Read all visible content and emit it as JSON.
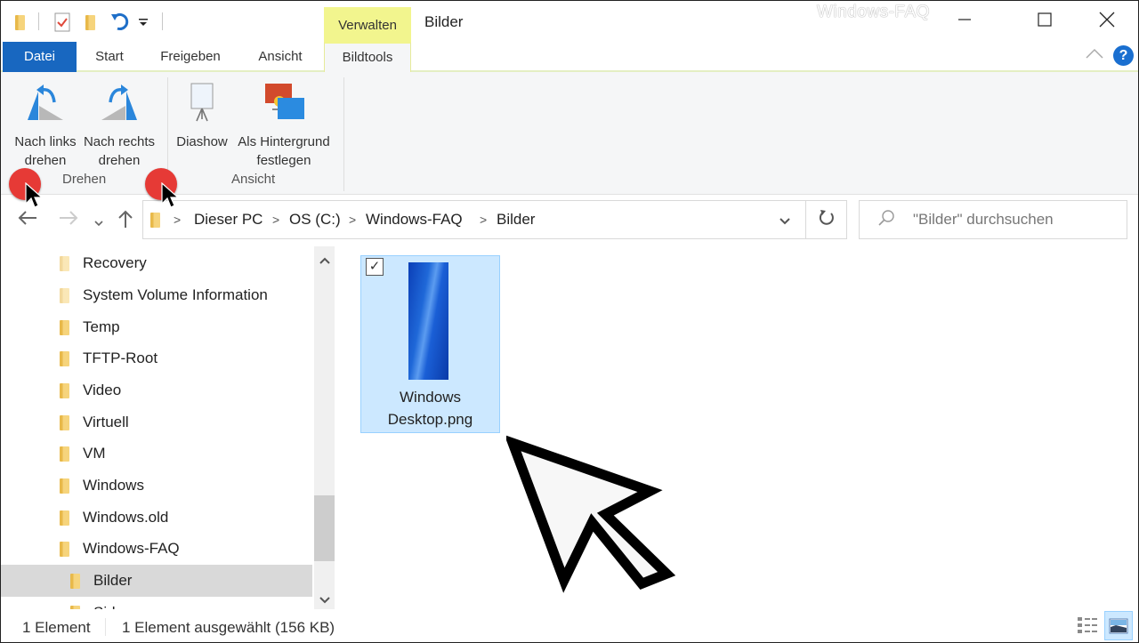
{
  "window": {
    "title": "Bilder",
    "watermark": "Windows-FAQ",
    "controls": {
      "minimize": "minimize-icon",
      "maximize": "maximize-icon",
      "close": "close-icon"
    }
  },
  "quick_access": {
    "icons": [
      "folder-icon",
      "properties-icon",
      "new-folder-icon",
      "undo-icon",
      "customize-dropdown-icon"
    ]
  },
  "ribbon": {
    "context_header": "Verwalten",
    "tabs": [
      {
        "label": "Datei",
        "active": false
      },
      {
        "label": "Start",
        "active": false
      },
      {
        "label": "Freigeben",
        "active": false
      },
      {
        "label": "Ansicht",
        "active": false
      },
      {
        "label": "Bildtools",
        "active": true
      }
    ],
    "groups": [
      {
        "label": "Drehen",
        "buttons": [
          {
            "line1": "Nach links",
            "line2": "drehen",
            "icon": "rotate-left-icon"
          },
          {
            "line1": "Nach rechts",
            "line2": "drehen",
            "icon": "rotate-right-icon"
          }
        ]
      },
      {
        "label": "Ansicht",
        "buttons": [
          {
            "line1": "Diashow",
            "line2": "",
            "icon": "slideshow-icon"
          },
          {
            "line1": "Als Hintergrund",
            "line2": "festlegen",
            "icon": "set-background-icon"
          }
        ]
      }
    ],
    "collapse_icon": "chevron-up-icon",
    "help_icon": "help-icon",
    "accent": "#1867c0",
    "context_color": "#f2f58e"
  },
  "navigation": {
    "breadcrumb": [
      "Dieser PC",
      "OS (C:)",
      "Windows-FAQ",
      "Bilder"
    ],
    "search_placeholder": "\"Bilder\" durchsuchen"
  },
  "nav_pane": {
    "items": [
      {
        "label": "Recovery",
        "selected": false,
        "level": 1
      },
      {
        "label": "System Volume Information",
        "selected": false,
        "level": 1
      },
      {
        "label": "Temp",
        "selected": false,
        "level": 1
      },
      {
        "label": "TFTP-Root",
        "selected": false,
        "level": 1
      },
      {
        "label": "Video",
        "selected": false,
        "level": 1
      },
      {
        "label": "Virtuell",
        "selected": false,
        "level": 1
      },
      {
        "label": "VM",
        "selected": false,
        "level": 1
      },
      {
        "label": "Windows",
        "selected": false,
        "level": 1
      },
      {
        "label": "Windows.old",
        "selected": false,
        "level": 1
      },
      {
        "label": "Windows-FAQ",
        "selected": false,
        "level": 1
      },
      {
        "label": "Bilder",
        "selected": true,
        "level": 2
      },
      {
        "label": "Sid...",
        "selected": false,
        "level": 2
      }
    ]
  },
  "files": [
    {
      "name_line1": "Windows",
      "name_line2": "Desktop.png",
      "selected": true,
      "checked": true
    }
  ],
  "status": {
    "count": "1 Element",
    "selection": "1 Element ausgewählt (156 KB)"
  },
  "view_toggle": {
    "details": "details-view-icon",
    "large_icons": "large-icons-view-icon",
    "active": "large_icons"
  }
}
